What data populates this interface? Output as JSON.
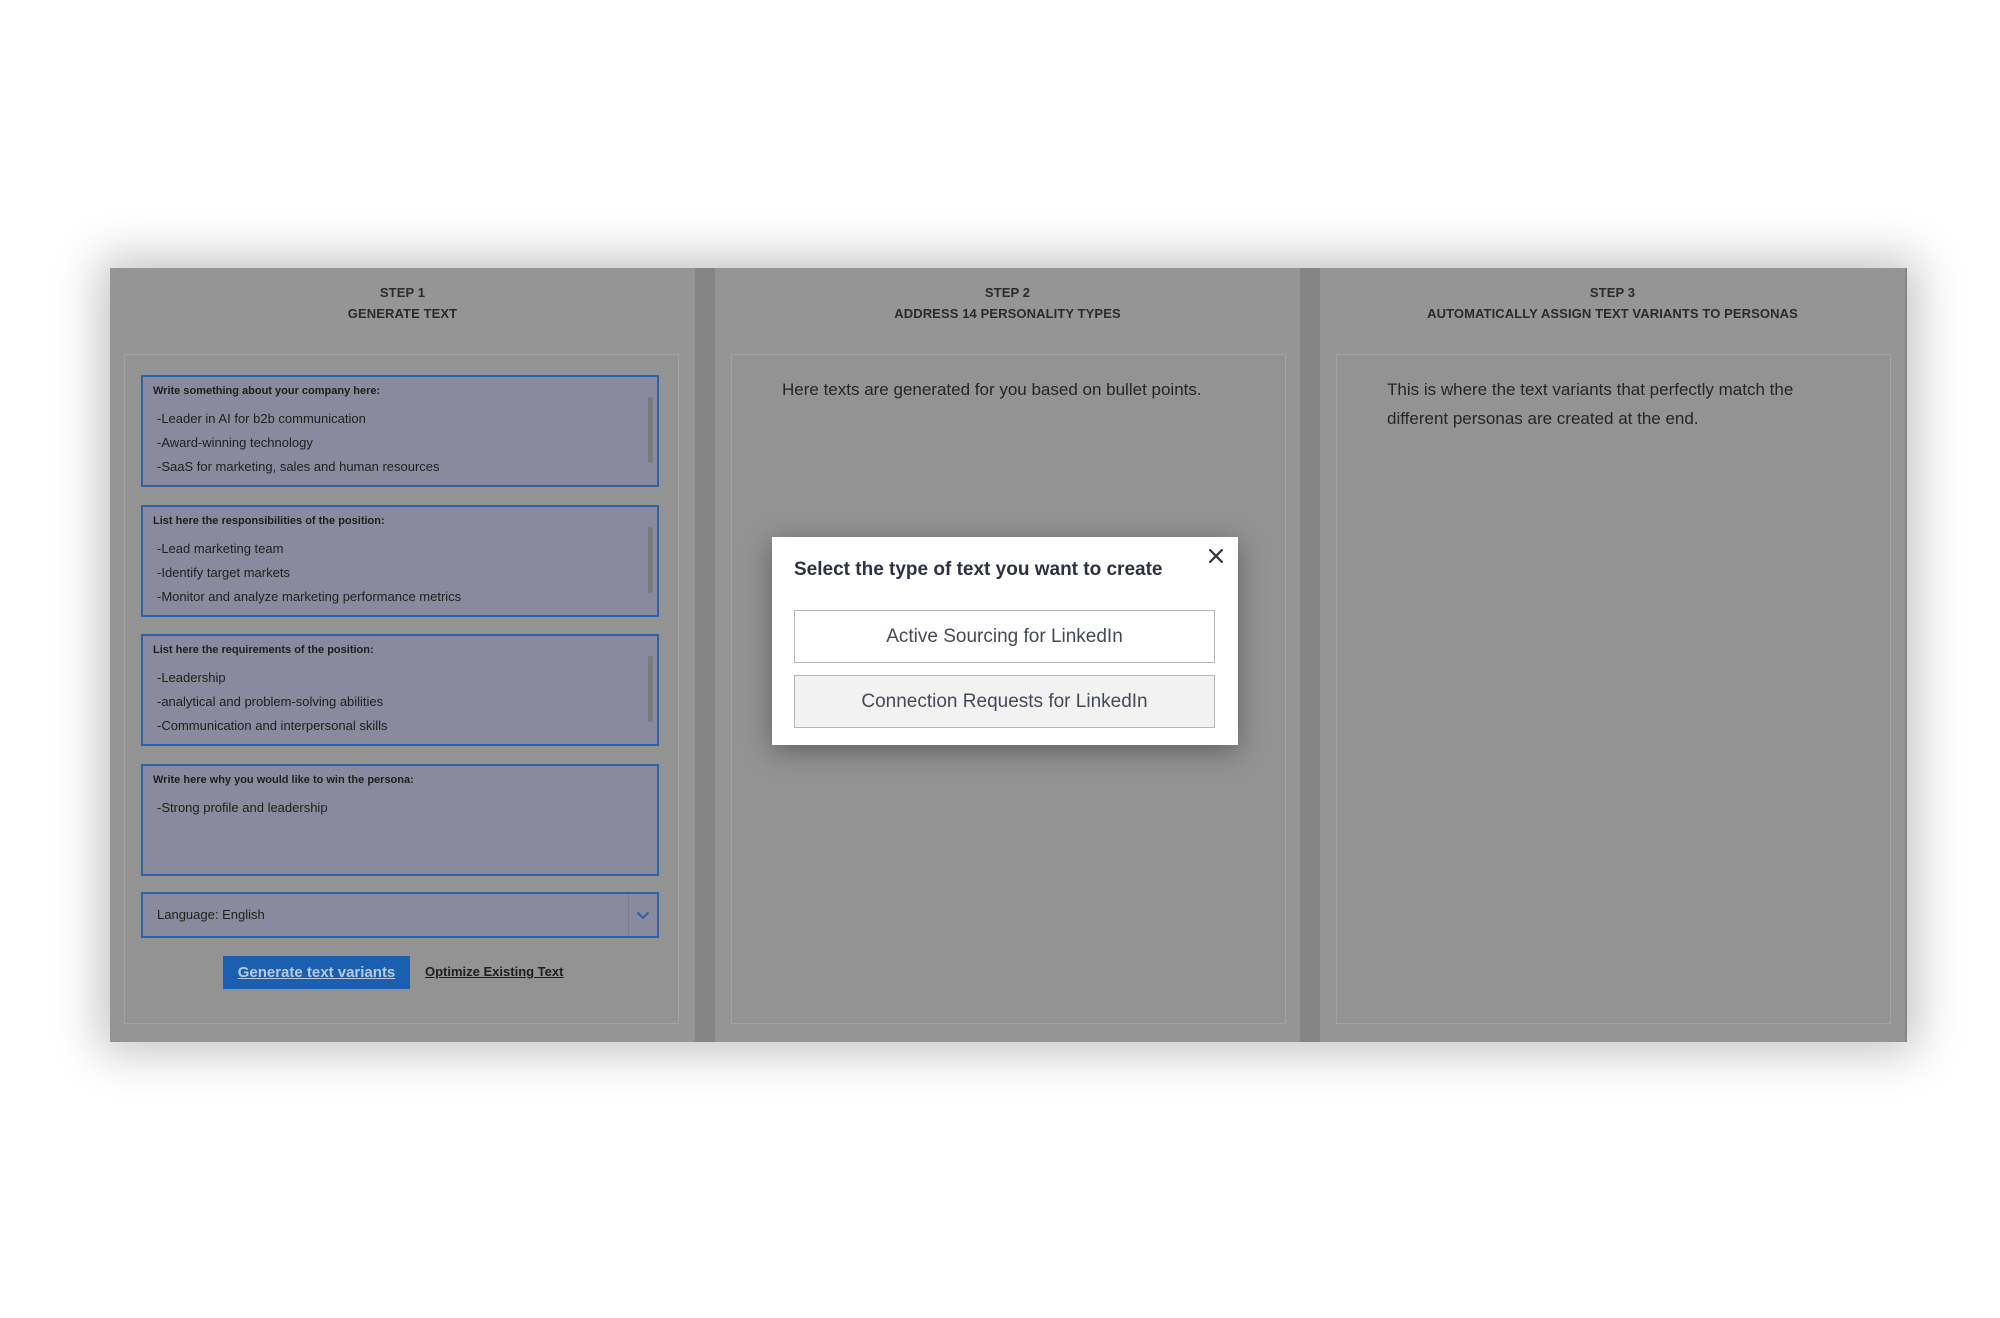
{
  "step1": {
    "step_label": "STEP 1",
    "title": "GENERATE TEXT",
    "fields": [
      {
        "label": "Write something about your company here:",
        "lines": [
          "-Leader in AI for b2b communication",
          "-Award-winning technology",
          "-SaaS for marketing, sales and human resources"
        ]
      },
      {
        "label": "List here the responsibilities of the position:",
        "lines": [
          "-Lead marketing team",
          "-Identify target markets",
          "-Monitor and analyze marketing performance metrics"
        ]
      },
      {
        "label": "List here the requirements of the position:",
        "lines": [
          "-Leadership",
          "-analytical and problem-solving abilities",
          "-Communication and interpersonal skills"
        ]
      },
      {
        "label": "Write here why you would like to win the persona:",
        "lines": [
          "-Strong profile and leadership"
        ]
      }
    ],
    "language_select": "Language: English",
    "generate_button": "Generate text variants",
    "optimize_link": "Optimize Existing Text"
  },
  "step2": {
    "step_label": "STEP 2",
    "title": "ADDRESS 14 PERSONALITY TYPES",
    "description": "Here texts are generated for you based on bullet points."
  },
  "step3": {
    "step_label": "STEP 3",
    "title": "AUTOMATICALLY ASSIGN TEXT VARIANTS TO PERSONAS",
    "description": "This is where the text variants that perfectly match the different personas are created at the end."
  },
  "modal": {
    "title": "Select the type of text you want to create",
    "close_icon": "close-icon",
    "options": [
      "Active Sourcing for LinkedIn",
      "Connection Requests for LinkedIn"
    ]
  },
  "colors": {
    "accent": "#1b5fb0",
    "field_border": "#2b63a6",
    "overlay": "#858585"
  }
}
